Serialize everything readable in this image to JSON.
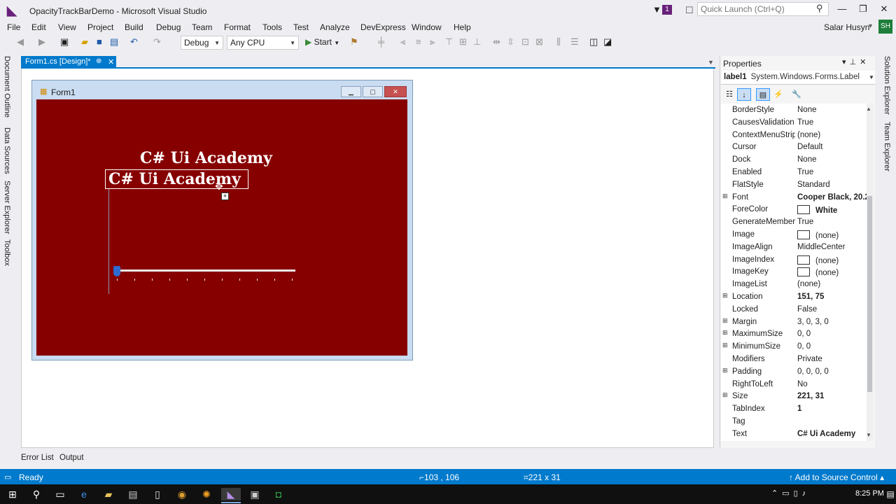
{
  "window": {
    "title": "OpacityTrackBarDemo - Microsoft Visual Studio",
    "notification_count": "1",
    "quick_launch_placeholder": "Quick Launch (Ctrl+Q)",
    "user_name": "Salar Husyn",
    "user_initials": "SH"
  },
  "menu": [
    "File",
    "Edit",
    "View",
    "Project",
    "Build",
    "Debug",
    "Team",
    "Format",
    "Tools",
    "Test",
    "Analyze",
    "DevExpress",
    "Window",
    "Help"
  ],
  "toolbar": {
    "configuration": "Debug",
    "platform": "Any CPU",
    "start_label": "Start"
  },
  "side_tabs_left": [
    "Document Outline",
    "Data Sources",
    "Server Explorer",
    "Toolbox"
  ],
  "side_tabs_right": [
    "Solution Explorer",
    "Team Explorer"
  ],
  "document": {
    "tab_label": "Form1.cs [Design]*",
    "form_title": "Form1",
    "form_back_color": "#870000",
    "label_back_text": "C# Ui Academy",
    "label_selected_text": "C# Ui Academy",
    "trackbar_value_fraction": 0
  },
  "properties": {
    "title": "Properties",
    "object_name": "label1",
    "object_type": "System.Windows.Forms.Label",
    "rows": [
      {
        "name": "BorderStyle",
        "value": "None",
        "expandable": false,
        "bold": false,
        "swatch": false
      },
      {
        "name": "CausesValidation",
        "value": "True",
        "expandable": false,
        "bold": false,
        "swatch": false
      },
      {
        "name": "ContextMenuStrip",
        "value": "(none)",
        "expandable": false,
        "bold": false,
        "swatch": false
      },
      {
        "name": "Cursor",
        "value": "Default",
        "expandable": false,
        "bold": false,
        "swatch": false
      },
      {
        "name": "Dock",
        "value": "None",
        "expandable": false,
        "bold": false,
        "swatch": false
      },
      {
        "name": "Enabled",
        "value": "True",
        "expandable": false,
        "bold": false,
        "swatch": false
      },
      {
        "name": "FlatStyle",
        "value": "Standard",
        "expandable": false,
        "bold": false,
        "swatch": false
      },
      {
        "name": "Font",
        "value": "Cooper Black, 20.2",
        "expandable": true,
        "bold": true,
        "swatch": false
      },
      {
        "name": "ForeColor",
        "value": "White",
        "expandable": false,
        "bold": true,
        "swatch": true
      },
      {
        "name": "GenerateMember",
        "value": "True",
        "expandable": false,
        "bold": false,
        "swatch": false
      },
      {
        "name": "Image",
        "value": "(none)",
        "expandable": false,
        "bold": false,
        "swatch": true
      },
      {
        "name": "ImageAlign",
        "value": "MiddleCenter",
        "expandable": false,
        "bold": false,
        "swatch": false
      },
      {
        "name": "ImageIndex",
        "value": "(none)",
        "expandable": false,
        "bold": false,
        "swatch": true
      },
      {
        "name": "ImageKey",
        "value": "(none)",
        "expandable": false,
        "bold": false,
        "swatch": true
      },
      {
        "name": "ImageList",
        "value": "(none)",
        "expandable": false,
        "bold": false,
        "swatch": false
      },
      {
        "name": "Location",
        "value": "151, 75",
        "expandable": true,
        "bold": true,
        "swatch": false
      },
      {
        "name": "Locked",
        "value": "False",
        "expandable": false,
        "bold": false,
        "swatch": false
      },
      {
        "name": "Margin",
        "value": "3, 0, 3, 0",
        "expandable": true,
        "bold": false,
        "swatch": false
      },
      {
        "name": "MaximumSize",
        "value": "0, 0",
        "expandable": true,
        "bold": false,
        "swatch": false
      },
      {
        "name": "MinimumSize",
        "value": "0, 0",
        "expandable": true,
        "bold": false,
        "swatch": false
      },
      {
        "name": "Modifiers",
        "value": "Private",
        "expandable": false,
        "bold": false,
        "swatch": false
      },
      {
        "name": "Padding",
        "value": "0, 0, 0, 0",
        "expandable": true,
        "bold": false,
        "swatch": false
      },
      {
        "name": "RightToLeft",
        "value": "No",
        "expandable": false,
        "bold": false,
        "swatch": false
      },
      {
        "name": "Size",
        "value": "221, 31",
        "expandable": true,
        "bold": true,
        "swatch": false
      },
      {
        "name": "TabIndex",
        "value": "1",
        "expandable": false,
        "bold": true,
        "swatch": false
      },
      {
        "name": "Tag",
        "value": "",
        "expandable": false,
        "bold": false,
        "swatch": false
      },
      {
        "name": "Text",
        "value": "C# Ui Academy",
        "expandable": false,
        "bold": true,
        "swatch": false
      }
    ]
  },
  "bottom_tabs": [
    "Error List",
    "Output"
  ],
  "status": {
    "ready": "Ready",
    "cursor_position": "103 , 106",
    "selection_size": "221 x 31",
    "source_control": "Add to Source Control",
    "color": "#007acc"
  },
  "taskbar": {
    "clock": "8:25 PM"
  }
}
